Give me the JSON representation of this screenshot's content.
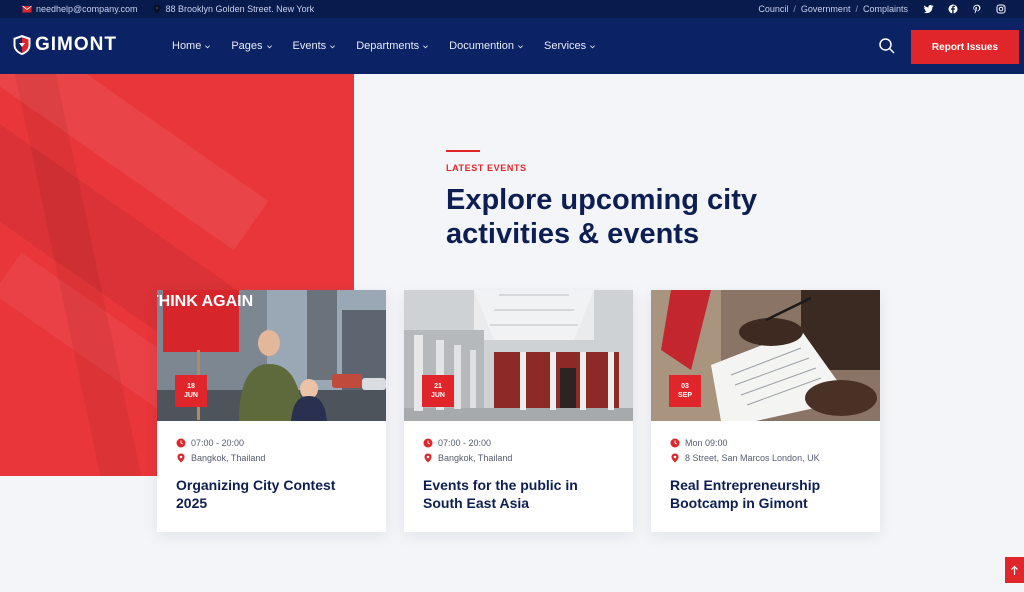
{
  "topbar": {
    "email": "needhelp@company.com",
    "address": "88 Brooklyn Golden Street. New York",
    "links": [
      "Council",
      "Government",
      "Complaints"
    ],
    "separator": "/",
    "social": [
      "twitter-icon",
      "facebook-icon",
      "pinterest-icon",
      "instagram-icon"
    ]
  },
  "nav": {
    "logo_text": "GIMONT",
    "menu": [
      {
        "label": "Home"
      },
      {
        "label": "Pages"
      },
      {
        "label": "Events"
      },
      {
        "label": "Departments"
      },
      {
        "label": "Documention"
      },
      {
        "label": "Services"
      }
    ],
    "cta_label": "Report Issues"
  },
  "section": {
    "eyebrow": "LATEST EVENTS",
    "title": "Explore upcoming city activities & events"
  },
  "events": [
    {
      "day": "18",
      "month": "JUN",
      "time": "07:00 - 20:00",
      "location": "Bangkok, Thailand",
      "title": "Organizing City Contest 2025",
      "sign_text": "THINK AGAIN"
    },
    {
      "day": "21",
      "month": "JUN",
      "time": "07:00 - 20:00",
      "location": "Bangkok, Thailand",
      "title": "Events for the public in South East Asia"
    },
    {
      "day": "03",
      "month": "SEP",
      "time": "Mon 09:00",
      "location": "8 Street, San Marcos London, UK",
      "title": "Real Entrepreneurship Bootcamp in Gimont"
    }
  ],
  "colors": {
    "navy": "#0b2265",
    "topbar": "#071b4d",
    "accent_red": "#e0262a",
    "hero_red": "#e8363a"
  }
}
